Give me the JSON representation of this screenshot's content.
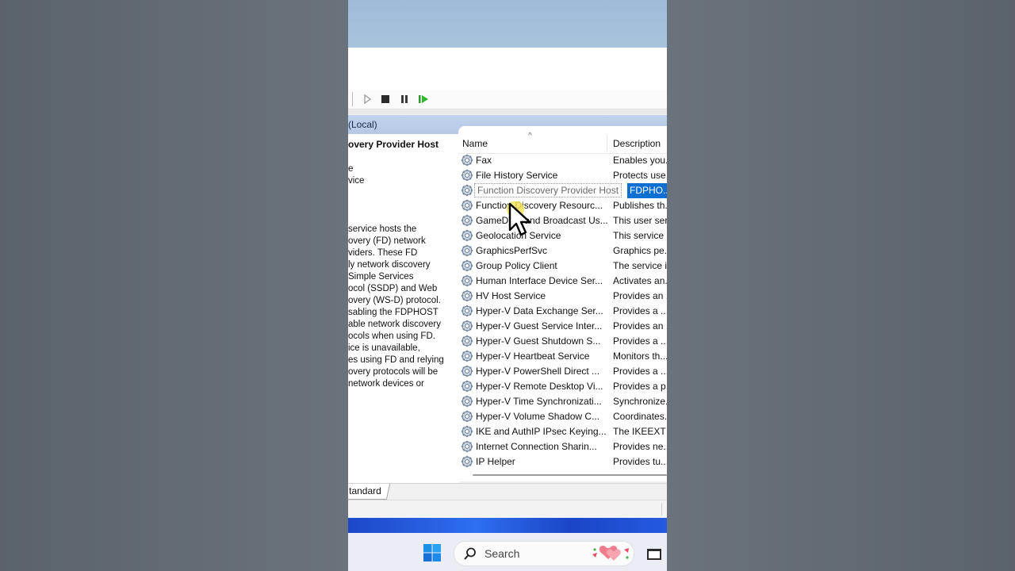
{
  "toolbar": {
    "buttons": [
      {
        "name": "play-disabled-icon"
      },
      {
        "name": "stop-icon"
      },
      {
        "name": "pause-icon"
      },
      {
        "name": "restart-icon"
      }
    ]
  },
  "header": {
    "title": "(Local)"
  },
  "left_pane": {
    "title": "overy Provider Host",
    "link_lines": [
      "e",
      "vice"
    ],
    "description_lines": [
      " service hosts the",
      "overy (FD) network",
      "viders. These FD",
      "ly network discovery",
      " Simple Services",
      "ocol (SSDP) and Web",
      "overy (WS-D) protocol.",
      "sabling the FDPHOST",
      "able network discovery",
      "ocols when using FD.",
      "ice is unavailable,",
      "es using FD and relying",
      "overy protocols will be",
      " network devices or"
    ]
  },
  "columns": {
    "name": "Name",
    "description": "Description",
    "sort_caret": "^"
  },
  "services": [
    {
      "name": "Fax",
      "description": "Enables you..."
    },
    {
      "name": "File History Service",
      "description": "Protects use..."
    },
    {
      "name": "Function Discovery Provider Host",
      "description": "FDPHO...",
      "selected": true
    },
    {
      "name": "Function Discovery Resourc...",
      "description": "Publishes th..."
    },
    {
      "name": "GameDVR and Broadcast Us...",
      "description": "This user ser..."
    },
    {
      "name": "Geolocation Service",
      "description": "This service ..."
    },
    {
      "name": "GraphicsPerfSvc",
      "description": "Graphics pe..."
    },
    {
      "name": "Group Policy Client",
      "description": "The service i..."
    },
    {
      "name": "Human Interface Device Ser...",
      "description": "Activates an..."
    },
    {
      "name": "HV Host Service",
      "description": "Provides an ..."
    },
    {
      "name": "Hyper-V Data Exchange Ser...",
      "description": "Provides a ..."
    },
    {
      "name": "Hyper-V Guest Service Inter...",
      "description": "Provides an ..."
    },
    {
      "name": "Hyper-V Guest Shutdown S...",
      "description": "Provides a ..."
    },
    {
      "name": "Hyper-V Heartbeat Service",
      "description": "Monitors th..."
    },
    {
      "name": "Hyper-V PowerShell Direct ...",
      "description": "Provides a ..."
    },
    {
      "name": "Hyper-V Remote Desktop Vi...",
      "description": "Provides a p..."
    },
    {
      "name": "Hyper-V Time Synchronizati...",
      "description": "Synchronize..."
    },
    {
      "name": "Hyper-V Volume Shadow C...",
      "description": "Coordinates..."
    },
    {
      "name": "IKE and AuthIP IPsec Keying...",
      "description": "The IKEEXT ..."
    },
    {
      "name": "Internet Connection Sharin...",
      "description": "Provides ne..."
    },
    {
      "name": "IP Helper",
      "description": "Provides tu..."
    }
  ],
  "tabs": {
    "standard": "tandard"
  },
  "taskbar": {
    "search_placeholder": "Search"
  },
  "colors": {
    "selection": "#0d6fd1",
    "header_band": "#b5c8e4",
    "taskbar": "#eaeef4"
  }
}
